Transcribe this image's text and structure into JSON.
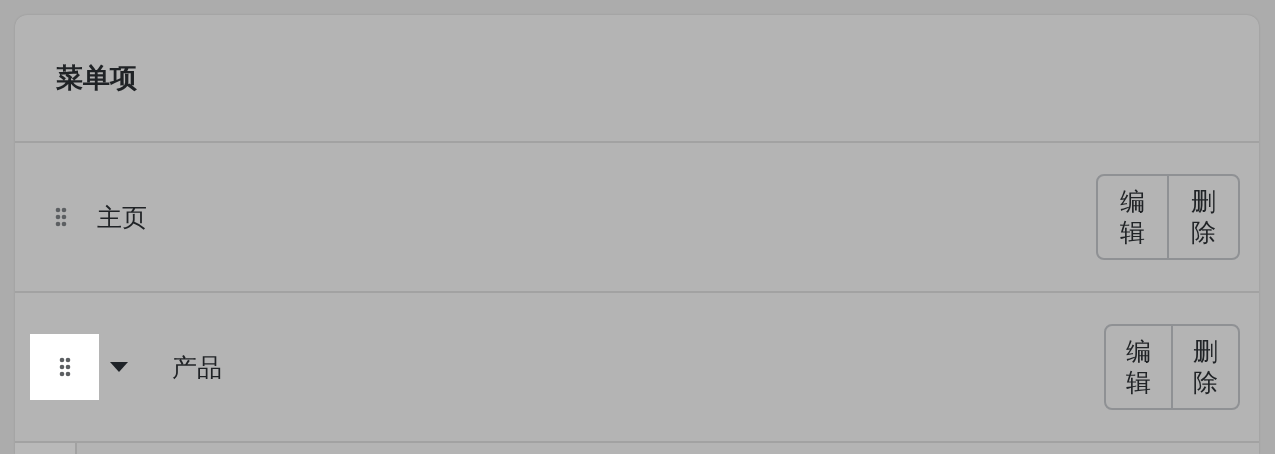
{
  "card": {
    "title": "菜单项"
  },
  "items": [
    {
      "kind": "leaf",
      "label": "主页",
      "focused": false,
      "buttons": [
        "编辑",
        "删除"
      ]
    },
    {
      "kind": "parent",
      "label": "产品",
      "focused": true,
      "expanded": true,
      "buttons": [
        "编辑",
        "删除"
      ]
    }
  ]
}
